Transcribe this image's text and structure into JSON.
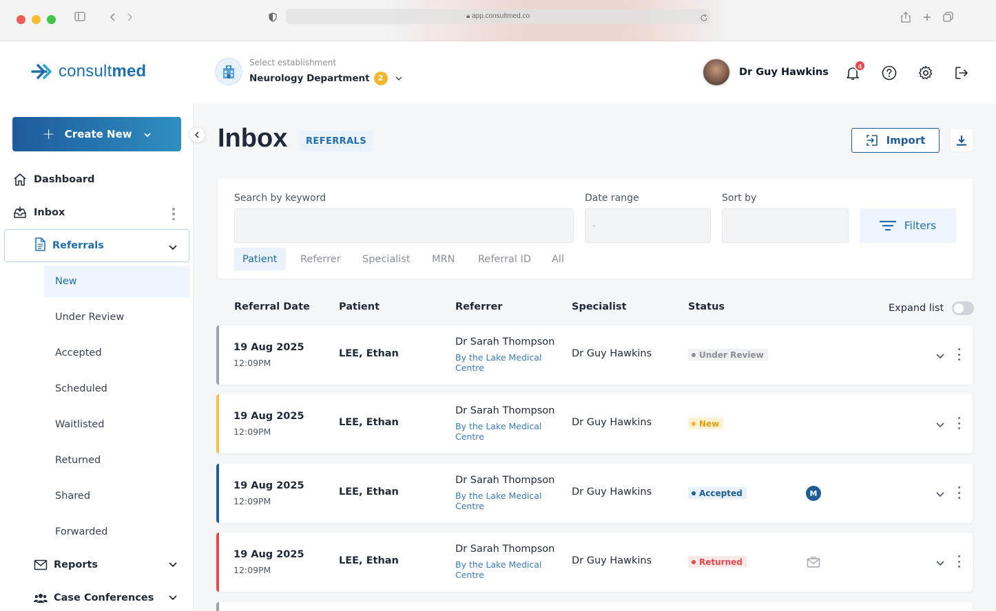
{
  "browser": {
    "url": "app.consultmed.co"
  },
  "brand": {
    "name_light": "consult",
    "name_bold": "med"
  },
  "establishment": {
    "label": "Select establishment",
    "name": "Neurology Department",
    "count": "2"
  },
  "user": {
    "name": "Dr Guy Hawkins",
    "notifications": "4"
  },
  "sidebar": {
    "create_label": "Create New",
    "dashboard": "Dashboard",
    "inbox": "Inbox",
    "referrals": "Referrals",
    "sub_items": [
      "New",
      "Under Review",
      "Accepted",
      "Scheduled",
      "Waitlisted",
      "Returned",
      "Shared",
      "Forwarded"
    ],
    "reports": "Reports",
    "case_conferences": "Case Conferences"
  },
  "page": {
    "title": "Inbox",
    "badge": "REFERRALS",
    "import_label": "Import"
  },
  "filters": {
    "search_label": "Search by keyword",
    "date_label": "Date range",
    "date_value": "-",
    "sort_label": "Sort by",
    "filters_label": "Filters",
    "tabs": [
      "Patient",
      "Referrer",
      "Specialist",
      "MRN",
      "Referral ID",
      "All"
    ]
  },
  "table": {
    "headers": [
      "Referral Date",
      "Patient",
      "Referrer",
      "Specialist",
      "Status"
    ],
    "expand_label": "Expand list",
    "rows": [
      {
        "date": "19 Aug 2025",
        "time": "12:09PM",
        "patient": "LEE, Ethan",
        "referrer": "Dr Sarah Thompson",
        "org": "By the Lake Medical Centre",
        "specialist": "Dr Guy Hawkins",
        "status": "Under Review",
        "extra": ""
      },
      {
        "date": "19 Aug 2025",
        "time": "12:09PM",
        "patient": "LEE, Ethan",
        "referrer": "Dr Sarah Thompson",
        "org": "By the Lake Medical Centre",
        "specialist": "Dr Guy Hawkins",
        "status": "New",
        "extra": ""
      },
      {
        "date": "19 Aug 2025",
        "time": "12:09PM",
        "patient": "LEE, Ethan",
        "referrer": "Dr Sarah Thompson",
        "org": "By the Lake Medical Centre",
        "specialist": "Dr Guy Hawkins",
        "status": "Accepted",
        "extra": "M"
      },
      {
        "date": "19 Aug 2025",
        "time": "12:09PM",
        "patient": "LEE, Ethan",
        "referrer": "Dr Sarah Thompson",
        "org": "By the Lake Medical Centre",
        "specialist": "Dr Guy Hawkins",
        "status": "Returned",
        "extra": "mail-icon"
      }
    ]
  },
  "colors": {
    "brand": "#1f6fb0",
    "under_review": "#9ca3af",
    "new": "#f5b52e",
    "accepted": "#1f5d96",
    "returned": "#e5484d"
  }
}
